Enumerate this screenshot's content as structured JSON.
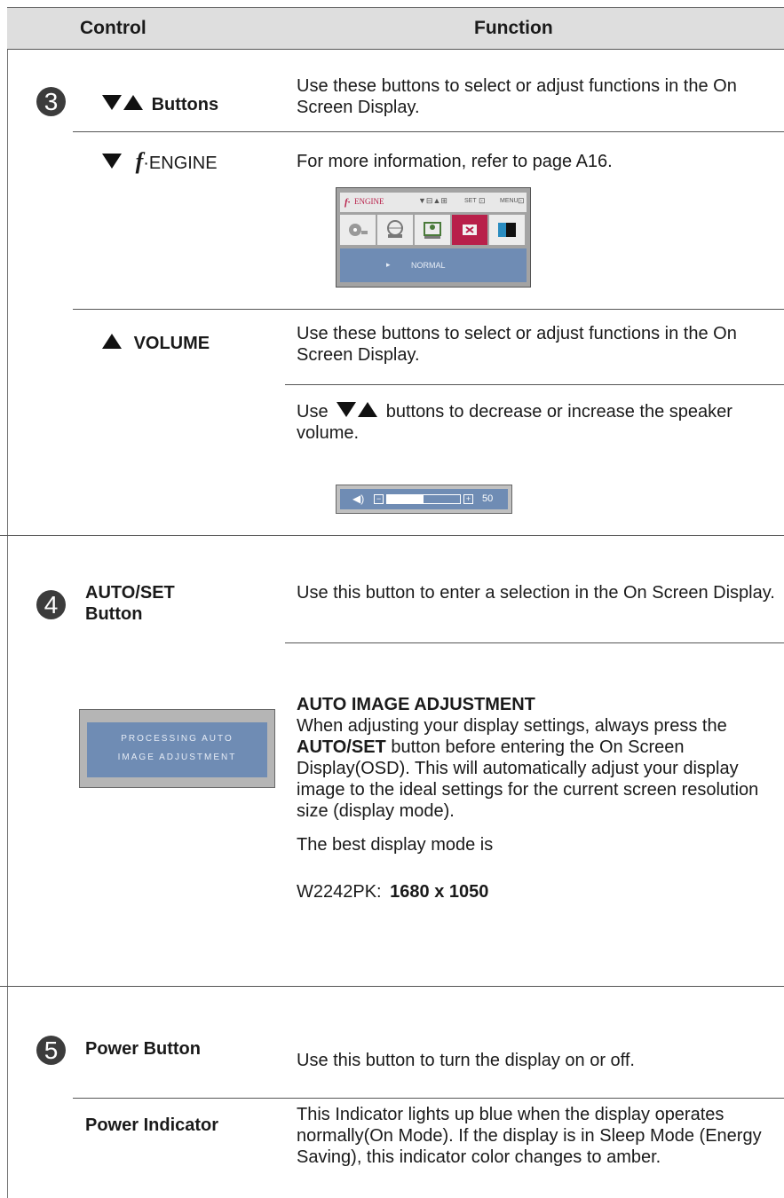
{
  "header": {
    "control": "Control",
    "function": "Function"
  },
  "section3": {
    "number": "3",
    "buttons_label": "Buttons",
    "buttons_desc": "Use these buttons to select or adjust functions in the On Screen Display.",
    "fengine_symbol": "f",
    "fengine_label": "ENGINE",
    "fengine_desc": "For more information, refer to page A16.",
    "osd": {
      "top_label": "ENGINE",
      "set_label": "SET",
      "menu_label": "MENU",
      "bar_value": "NORMAL",
      "accent": "#b8204a",
      "bar_color": "#6f8cb4"
    },
    "volume_label": "VOLUME",
    "volume_desc1": "Use these buttons to select or adjust functions in the On Screen Display.",
    "volume_desc2_pre": "Use",
    "volume_desc2_post": "buttons to decrease or increase the speaker volume.",
    "volume_osd": {
      "value": "50",
      "level_percent": 50,
      "icon": "speaker-icon"
    }
  },
  "section4": {
    "number": "4",
    "label_line1": "AUTO/SET",
    "label_line2": "Button",
    "desc": "Use this button to enter a selection in the On Screen Display.",
    "processing_line1": "PROCESSING AUTO",
    "processing_line2": "IMAGE ADJUSTMENT",
    "auto_title": "AUTO IMAGE ADJUSTMENT",
    "auto_p1": "When adjusting your display settings, always press the",
    "auto_bold": "AUTO/SET",
    "auto_p2": "button before entering the On Screen Display(OSD). This will automatically adjust your display image to the ideal settings for the current screen resolution size (display mode).",
    "best_mode": "The best display mode is",
    "model": "W2242PK:",
    "resolution": "1680 x 1050"
  },
  "section5": {
    "number": "5",
    "power_button_label": "Power Button",
    "power_button_desc": "Use this button to turn the display on or off.",
    "power_indicator_label": "Power Indicator",
    "power_indicator_desc": "This Indicator lights up blue when the display operates normally(On Mode). If the display is in Sleep Mode (Energy Saving), this indicator color changes to amber."
  }
}
